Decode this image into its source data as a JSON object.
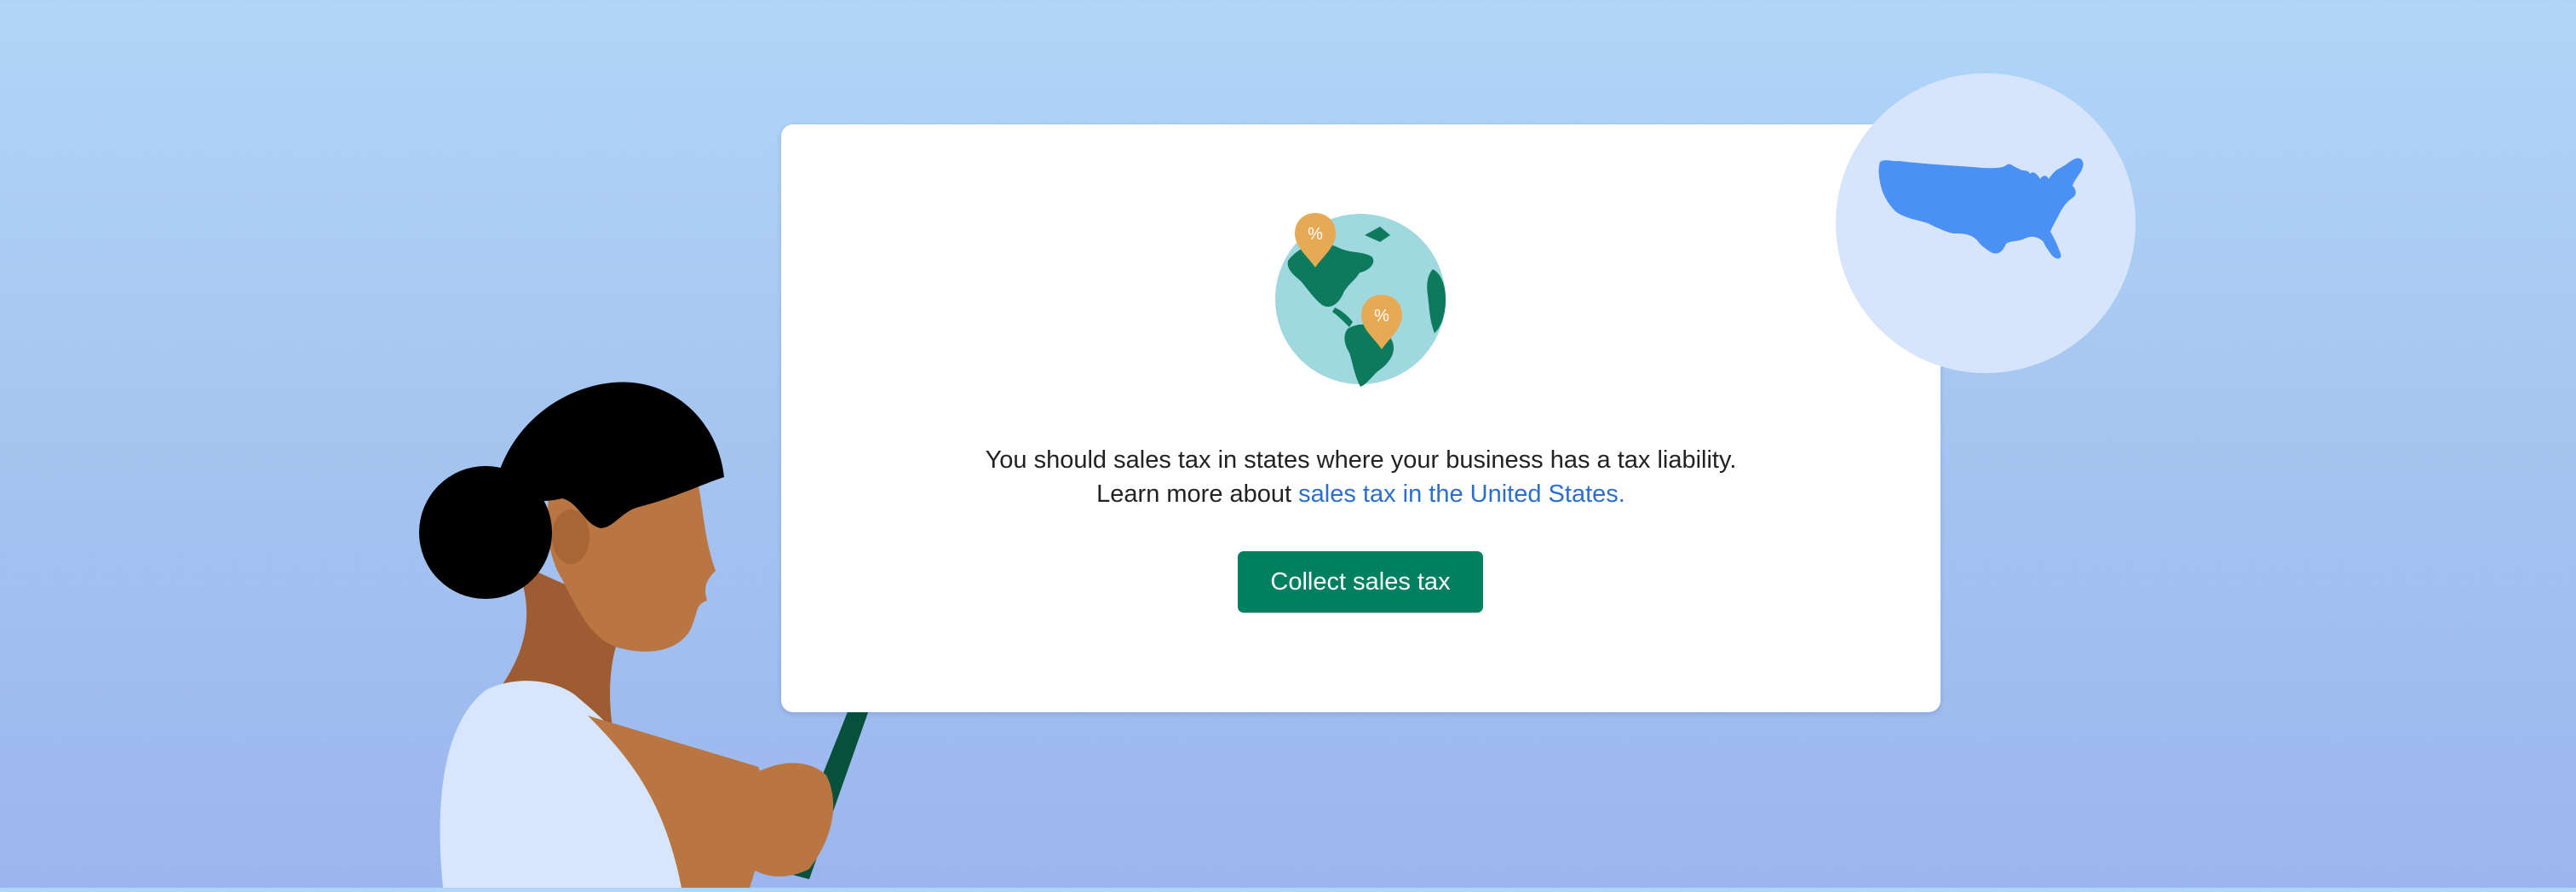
{
  "dialog": {
    "line1": "You should sales tax in states where your business has a tax liability.",
    "line2_prefix": "Learn more about ",
    "link_text": "sales tax in the United States.",
    "button_label": "Collect sales tax"
  },
  "icons": {
    "globe": "globe-tax-icon",
    "usa_map": "usa-map-icon",
    "person": "person-with-phone-illustration"
  },
  "colors": {
    "primary_button": "#008060",
    "link": "#2c6ecb",
    "map_blue": "#4a90f5",
    "badge_bg": "#d6e5fc",
    "globe_water": "#a0d8e0",
    "globe_land": "#0d7a5c",
    "pin": "#e6aa55"
  }
}
